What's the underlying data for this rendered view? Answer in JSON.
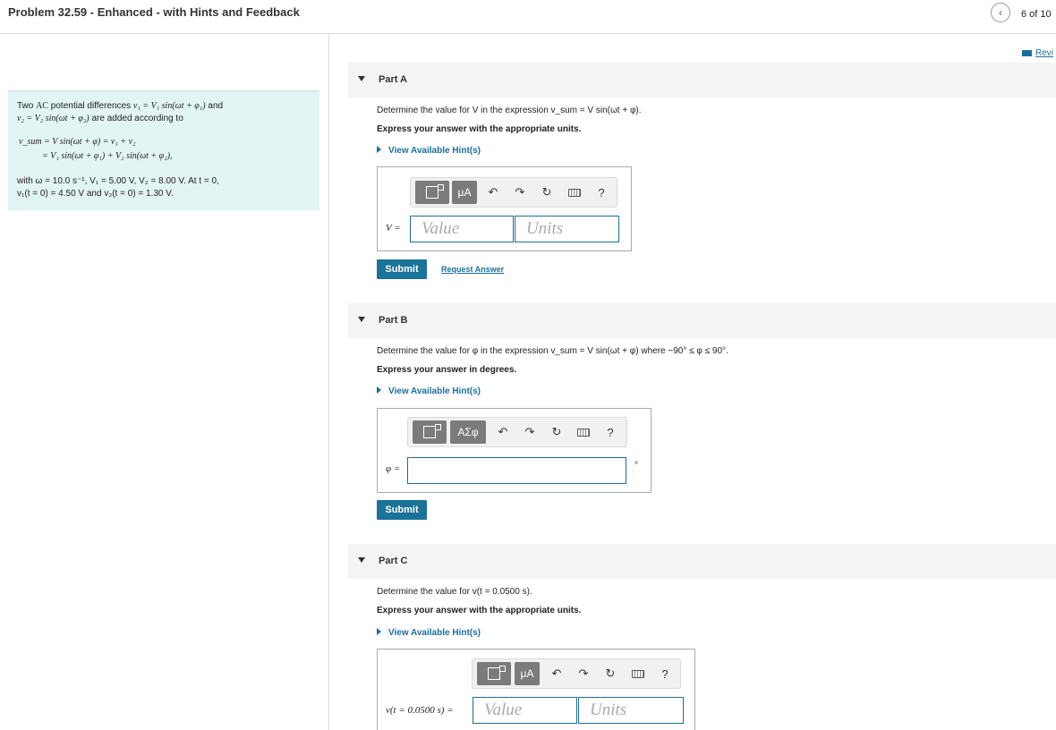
{
  "header": {
    "title": "Problem 32.59 - Enhanced - with Hints and Feedback",
    "counter": "6 of 10"
  },
  "review_link": "Revi",
  "problem": {
    "line1_a": "Two ",
    "line1_ac": "AC",
    "line1_b": " potential differences ",
    "line1_eq": "v₁ = V₁ sin(ωt + φ₁)",
    "line1_c": " and",
    "line2_eq": "v₂ = V₂ sin(ωt + φ₂)",
    "line2_b": " are added according to",
    "eq1": "v_sum = V sin(ωt + φ) = v₁ + v₂",
    "eq2": "= V₁ sin(ωt + φ₁) + V₂ sin(ωt + φ₂),",
    "with_line": "with ω = 10.0 s⁻¹, V₁ = 5.00 V, V₂ = 8.00 V. At t = 0,",
    "init_line": "v₁(t = 0) = 4.50 V and v₂(t = 0) = 1.30 V."
  },
  "partA": {
    "label": "Part A",
    "question": "Determine the value for V in the expression v_sum = V sin(ωt + φ).",
    "instruction": "Express your answer with the appropriate units.",
    "hint": "View Available Hint(s)",
    "var_label": "V =",
    "value_placeholder": "Value",
    "units_placeholder": "Units",
    "submit": "Submit",
    "request": "Request Answer"
  },
  "partB": {
    "label": "Part B",
    "question": "Determine the value for φ in the expression v_sum = V sin(ωt + φ) where −90° ≤ φ ≤ 90°.",
    "instruction": "Express your answer in degrees.",
    "hint": "View Available Hint(s)",
    "var_label": "φ =",
    "unit_suffix": "°",
    "submit": "Submit"
  },
  "partC": {
    "label": "Part C",
    "question": "Determine the value for v(t = 0.0500 s).",
    "instruction": "Express your answer with the appropriate units.",
    "hint": "View Available Hint(s)",
    "var_label": "v(t = 0.0500 s) =",
    "value_placeholder": "Value",
    "units_placeholder": "Units"
  },
  "toolbar": {
    "mu_label": "μA",
    "greek_label": "ΑΣφ",
    "help": "?"
  },
  "icons": [
    "chevron-left-icon",
    "book-icon",
    "caret-down-icon",
    "hint-triangle-icon",
    "template-icon",
    "undo-icon",
    "redo-icon",
    "reset-icon",
    "keyboard-icon",
    "help-icon"
  ]
}
